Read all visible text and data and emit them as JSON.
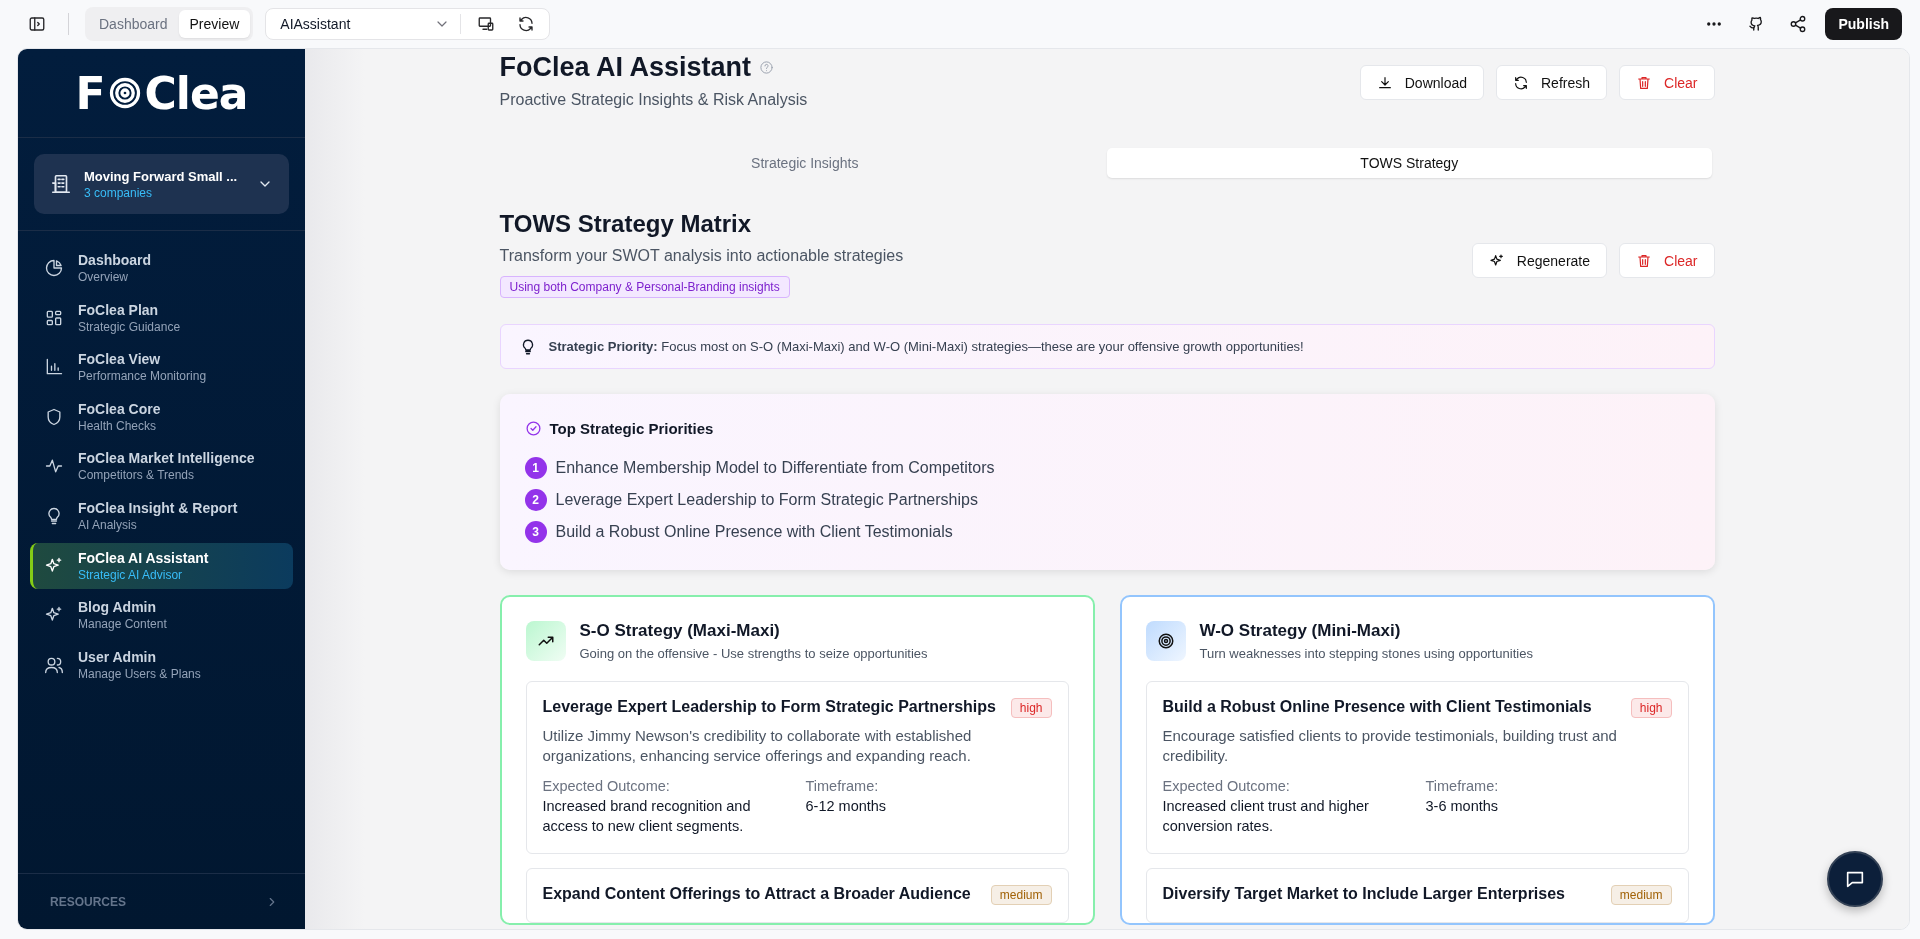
{
  "toolbar": {
    "view_tabs": [
      {
        "label": "Dashboard",
        "selected": false
      },
      {
        "label": "Preview",
        "selected": true
      }
    ],
    "page_select": {
      "value": "AIAssistant"
    },
    "publish": "Publish"
  },
  "sidebar": {
    "logo": {
      "start": "F",
      "end": "Clea"
    },
    "workspace": {
      "name": "Moving Forward Small ...",
      "count": "3 companies"
    },
    "items": [
      {
        "title": "Dashboard",
        "subtitle": "Overview",
        "selected": false
      },
      {
        "title": "FoClea Plan",
        "subtitle": "Strategic Guidance",
        "selected": false
      },
      {
        "title": "FoClea View",
        "subtitle": "Performance Monitoring",
        "selected": false
      },
      {
        "title": "FoClea Core",
        "subtitle": "Health Checks",
        "selected": false
      },
      {
        "title": "FoClea Market Intelligence",
        "subtitle": "Competitors & Trends",
        "selected": false
      },
      {
        "title": "FoClea Insight & Report",
        "subtitle": "AI Analysis",
        "selected": false
      },
      {
        "title": "FoClea AI Assistant",
        "subtitle": "Strategic AI Advisor",
        "selected": true
      },
      {
        "title": "Blog Admin",
        "subtitle": "Manage Content",
        "selected": false
      },
      {
        "title": "User Admin",
        "subtitle": "Manage Users & Plans",
        "selected": false
      }
    ],
    "footer": "RESOURCES"
  },
  "header": {
    "title": "FoClea AI Assistant",
    "subtitle": "Proactive Strategic Insights & Risk Analysis",
    "buttons": [
      {
        "kind": "download",
        "label": "Download"
      },
      {
        "kind": "refresh",
        "label": "Refresh"
      },
      {
        "kind": "delete",
        "label": "Clear"
      }
    ]
  },
  "tabs": [
    {
      "label": "Strategic Insights",
      "selected": false
    },
    {
      "label": "TOWS Strategy",
      "selected": true
    }
  ],
  "matrix": {
    "title": "TOWS Strategy Matrix",
    "subtitle": "Transform your SWOT analysis into actionable strategies",
    "buttons": [
      {
        "kind": "regenerate",
        "label": "Regenerate"
      },
      {
        "kind": "delete",
        "label": "Clear"
      }
    ],
    "source_badge": "Using both Company & Personal-Branding insights",
    "priority_note": "**Strategic Priority:** Focus most on S-O (Maxi-Maxi) and W-O (Mini-Maxi) strategies—these are your offensive growth opportunities!",
    "priorities": {
      "title": "Top Strategic Priorities",
      "items": [
        {
          "number": "1",
          "text": "Enhance Membership Model to Differentiate from Competitors"
        },
        {
          "number": "2",
          "text": "Leverage Expert Leadership to Form Strategic Partnerships"
        },
        {
          "number": "3",
          "text": "Build a Robust Online Presence with Client Testimonials"
        }
      ]
    },
    "strategies": [
      {
        "kind": "trend",
        "color": "#86efac",
        "title": "S-O Strategy (Maxi-Maxi)",
        "subtitle": "Going on the offensive - Use strengths to seize opportunities",
        "cards": [
          {
            "title": "Leverage Expert Leadership to Form Strategic Partnerships",
            "badge": "high",
            "color": "#dc2626",
            "description": "Utilize Jimmy Newson's credibility to collaborate with established organizations, enhancing service offerings and expanding reach.",
            "outcome_label": "Expected Outcome:",
            "outcome": "Increased brand recognition and access to new client segments.",
            "timeframe_label": "Timeframe:",
            "timeframe": "6-12 months"
          },
          {
            "title": "Expand Content Offerings to Attract a Broader Audience",
            "badge": "medium",
            "color": "#a16207"
          }
        ]
      },
      {
        "kind": "target",
        "color": "#93c5fd",
        "title": "W-O Strategy (Mini-Maxi)",
        "subtitle": "Turn weaknesses into stepping stones using opportunities",
        "cards": [
          {
            "title": "Build a Robust Online Presence with Client Testimonials",
            "badge": "high",
            "color": "#dc2626",
            "description": "Encourage satisfied clients to provide testimonials, building trust and credibility.",
            "outcome_label": "Expected Outcome:",
            "outcome": "Increased client trust and higher conversion rates.",
            "timeframe_label": "Timeframe:",
            "timeframe": "3-6 months"
          },
          {
            "title": "Diversify Target Market to Include Larger Enterprises",
            "badge": "medium",
            "color": "#a16207"
          }
        ]
      }
    ]
  }
}
